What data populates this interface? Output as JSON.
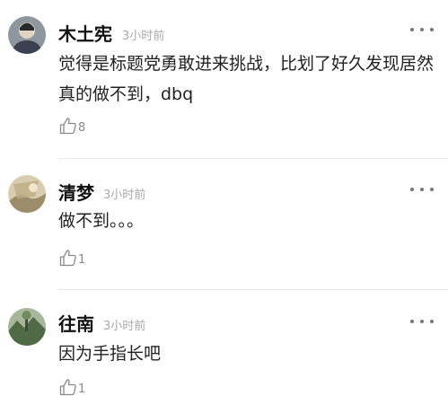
{
  "comments": [
    {
      "username": "木土宪",
      "timestamp": "3小时前",
      "text": "觉得是标题党勇敢进来挑战，比划了好久发现居然真的做不到，dbq",
      "likes": "8",
      "avatar_color": "#5a6270"
    },
    {
      "username": "清梦",
      "timestamp": "3小时前",
      "text": "做不到。。。",
      "likes": "1",
      "avatar_color": "#c9b58a"
    },
    {
      "username": "往南",
      "timestamp": "3小时前",
      "text": "因为手指长吧",
      "likes": "1",
      "avatar_color": "#5f7a52"
    }
  ],
  "icons": {
    "more": "more-horizontal-icon",
    "like": "thumbs-up-icon"
  }
}
